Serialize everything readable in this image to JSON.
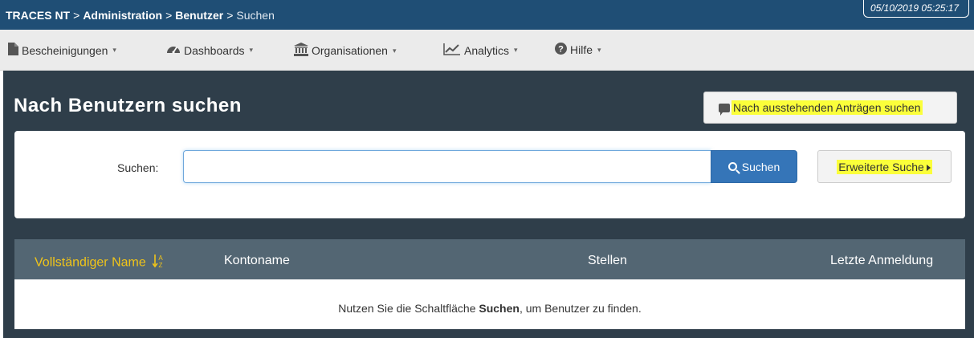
{
  "breadcrumb": {
    "items": [
      "TRACES NT",
      "Administration",
      "Benutzer",
      "Suchen"
    ],
    "separator": ">",
    "timestamp": "05/10/2019 05:25:17"
  },
  "menu": [
    {
      "label": "Bescheinigungen",
      "icon": "file-icon"
    },
    {
      "label": "Dashboards",
      "icon": "dashboard-icon"
    },
    {
      "label": "Organisationen",
      "icon": "institution-icon"
    },
    {
      "label": "Analytics",
      "icon": "line-chart-icon"
    },
    {
      "label": "Hilfe",
      "icon": "question-circle-icon"
    }
  ],
  "page": {
    "title": "Nach Benutzern suchen",
    "pending_button": "Nach ausstehenden Anträgen suchen"
  },
  "search": {
    "label": "Suchen:",
    "value": "",
    "button": "Suchen",
    "advanced": "Erweiterte Suche"
  },
  "table": {
    "columns": [
      "Vollständiger Name",
      "Kontoname",
      "Stellen",
      "Letzte Anmeldung"
    ],
    "empty": {
      "before": "Nutzen Sie die Schaltfläche ",
      "strong": "Suchen",
      "after": ", um Benutzer zu finden."
    }
  },
  "colors": {
    "topbar": "#1f4e75",
    "content_bg": "#2f3e4a",
    "table_header": "#536673",
    "sorted_column": "#f0c419",
    "primary_button": "#3575b8",
    "highlight": "#fbff3a"
  }
}
